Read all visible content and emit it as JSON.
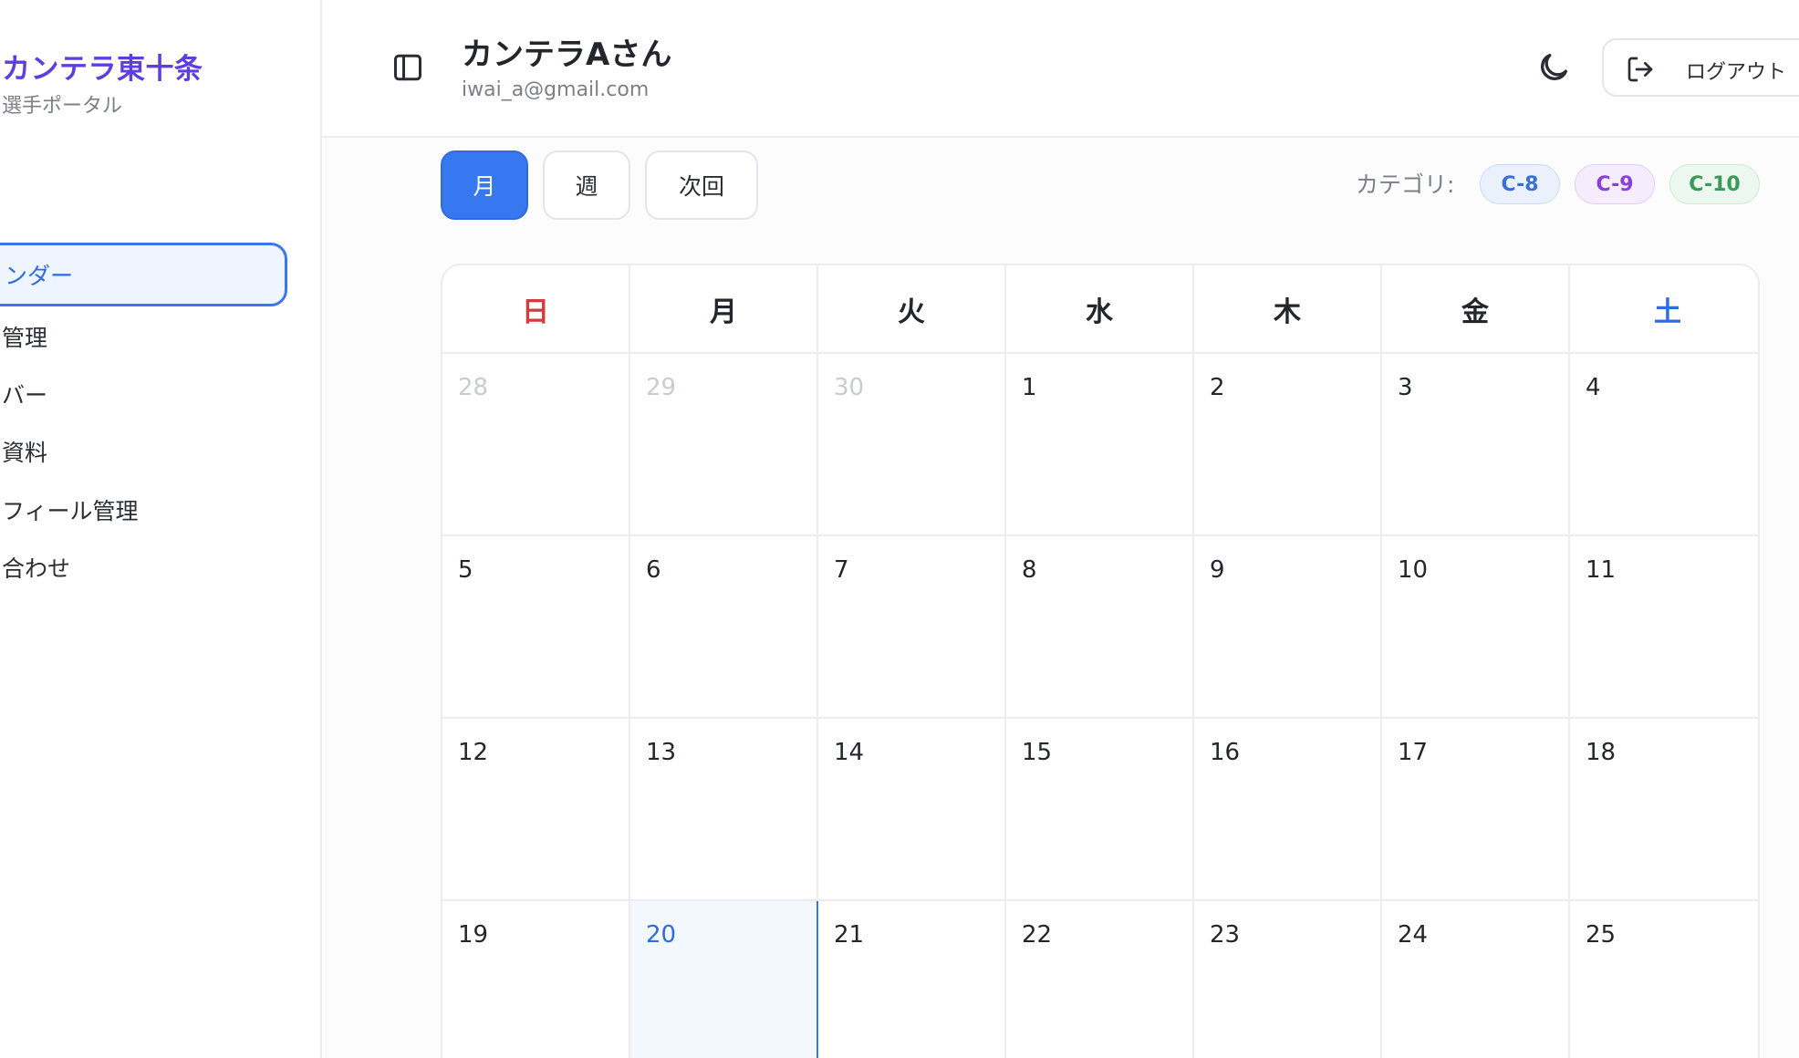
{
  "sidebar": {
    "brand_title": "カンテラ東十条",
    "brand_subtitle": "選手ポータル",
    "items": [
      {
        "label": "ンダー",
        "active": true
      },
      {
        "label": "管理",
        "active": false
      },
      {
        "label": "バー",
        "active": false
      },
      {
        "label": "資料",
        "active": false
      },
      {
        "label": "フィール管理",
        "active": false
      },
      {
        "label": "合わせ",
        "active": false
      }
    ]
  },
  "header": {
    "user_name": "カンテラAさん",
    "user_email": "iwai_a@gmail.com",
    "logout_label": "ログアウト",
    "icons": {
      "sidebar_toggle": "panel-left-icon",
      "theme_toggle": "moon-icon",
      "logout": "log-out-icon"
    }
  },
  "toolbar": {
    "views": [
      {
        "label": "月",
        "active": true
      },
      {
        "label": "週",
        "active": false
      },
      {
        "label": "次回",
        "active": false
      }
    ],
    "category_label": "カテゴリ:",
    "categories": [
      {
        "label": "C-8",
        "color": "#3a6fd8",
        "bg": "#eaf1fd",
        "border": "#c9dbf8"
      },
      {
        "label": "C-9",
        "color": "#8a3fd6",
        "bg": "#f5ecfd",
        "border": "#e2cdf8"
      },
      {
        "label": "C-10",
        "color": "#3a9a55",
        "bg": "#ecf7ef",
        "border": "#cbe9d3"
      }
    ]
  },
  "calendar": {
    "weekdays": [
      {
        "label": "日",
        "color": "#d43b3b"
      },
      {
        "label": "月",
        "color": "#23262b"
      },
      {
        "label": "火",
        "color": "#23262b"
      },
      {
        "label": "水",
        "color": "#23262b"
      },
      {
        "label": "木",
        "color": "#23262b"
      },
      {
        "label": "金",
        "color": "#23262b"
      },
      {
        "label": "土",
        "color": "#2f6be0"
      }
    ],
    "weeks": [
      [
        {
          "d": "28",
          "muted": true
        },
        {
          "d": "29",
          "muted": true
        },
        {
          "d": "30",
          "muted": true
        },
        {
          "d": "1"
        },
        {
          "d": "2"
        },
        {
          "d": "3"
        },
        {
          "d": "4"
        }
      ],
      [
        {
          "d": "5"
        },
        {
          "d": "6"
        },
        {
          "d": "7"
        },
        {
          "d": "8"
        },
        {
          "d": "9"
        },
        {
          "d": "10"
        },
        {
          "d": "11"
        }
      ],
      [
        {
          "d": "12"
        },
        {
          "d": "13"
        },
        {
          "d": "14"
        },
        {
          "d": "15"
        },
        {
          "d": "16"
        },
        {
          "d": "17"
        },
        {
          "d": "18"
        }
      ],
      [
        {
          "d": "19"
        },
        {
          "d": "20",
          "today": true
        },
        {
          "d": "21"
        },
        {
          "d": "22"
        },
        {
          "d": "23"
        },
        {
          "d": "24"
        },
        {
          "d": "25"
        }
      ]
    ]
  }
}
